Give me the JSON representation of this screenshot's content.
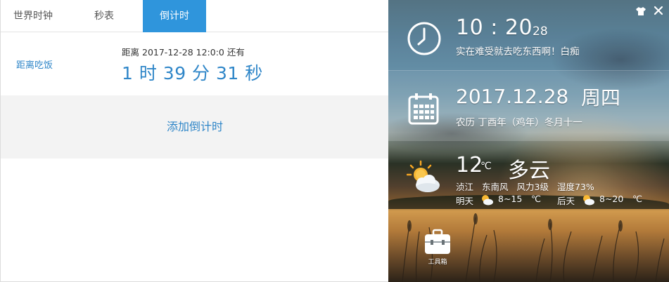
{
  "tabs": [
    {
      "label": "世界时钟",
      "active": false
    },
    {
      "label": "秒表",
      "active": false
    },
    {
      "label": "倒计时",
      "active": true
    }
  ],
  "countdown": {
    "name": "距离吃饭",
    "target_prefix": "距离",
    "target_datetime": "2017-12-28 12:0:0",
    "target_suffix": "还有",
    "remaining": "1 时 39 分 31 秒"
  },
  "add_label": "添加倒计时",
  "widget": {
    "time": {
      "hour_minute": "10 : 20",
      "seconds": "28",
      "message": "实在难受就去吃东西啊！白痴"
    },
    "date": {
      "date": "2017.12.28",
      "weekday": "周四",
      "lunar": "农历 丁酉年（鸡年）冬月十一"
    },
    "weather": {
      "temp": "12",
      "temp_unit": "℃",
      "condition": "多云",
      "city": "浈江",
      "wind_dir": "东南风",
      "wind_level": "风力3级",
      "humidity": "湿度73%",
      "forecast": [
        {
          "label": "明天",
          "range": "8~15",
          "unit": "℃",
          "icon": "partly-cloudy-icon"
        },
        {
          "label": "后天",
          "range": "8~20",
          "unit": "℃",
          "icon": "partly-cloudy-icon"
        }
      ]
    },
    "toolbox_label": "工具箱",
    "colors": {
      "accent": "#2f95dc",
      "link": "#2f86c8",
      "add_bg": "#f3f3f3"
    }
  }
}
